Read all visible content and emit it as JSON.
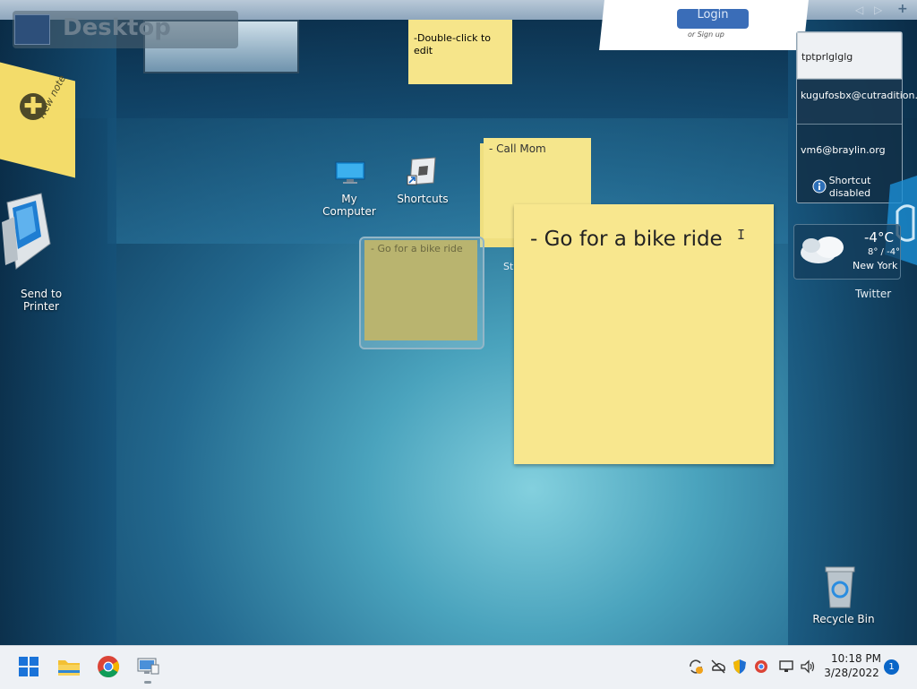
{
  "desktop": {
    "title": "Desktop"
  },
  "login": {
    "button": "Login",
    "signup": "or Sign up"
  },
  "notes": {
    "double_click": "-Double-click to edit",
    "new_note": "New note",
    "stack_top": "- Call Mom",
    "stack_label": "St",
    "bike_small": "- Go for a bike ride",
    "bike_big": "- Go for a bike ride"
  },
  "icons": {
    "my_computer": "My Computer",
    "shortcuts": "Shortcuts",
    "send_to_printer": "Send to Printer",
    "recycle_bin": "Recycle Bin",
    "twitter": "Twitter"
  },
  "right_panel": {
    "items": [
      "tptprlglglg",
      "kugufosbx@cutradition.com",
      "vm6@braylin.org"
    ],
    "shortcut_status": "Shortcut disabled"
  },
  "weather": {
    "temp": "-4°C",
    "range": "8° / -4°",
    "city": "New York"
  },
  "taskbar": {
    "time": "10:18 PM",
    "date": "3/28/2022",
    "notifications": "1"
  },
  "colors": {
    "note_yellow": "#f8e78e",
    "taskbar": "#eef1f5",
    "accent": "#0a66c8"
  }
}
